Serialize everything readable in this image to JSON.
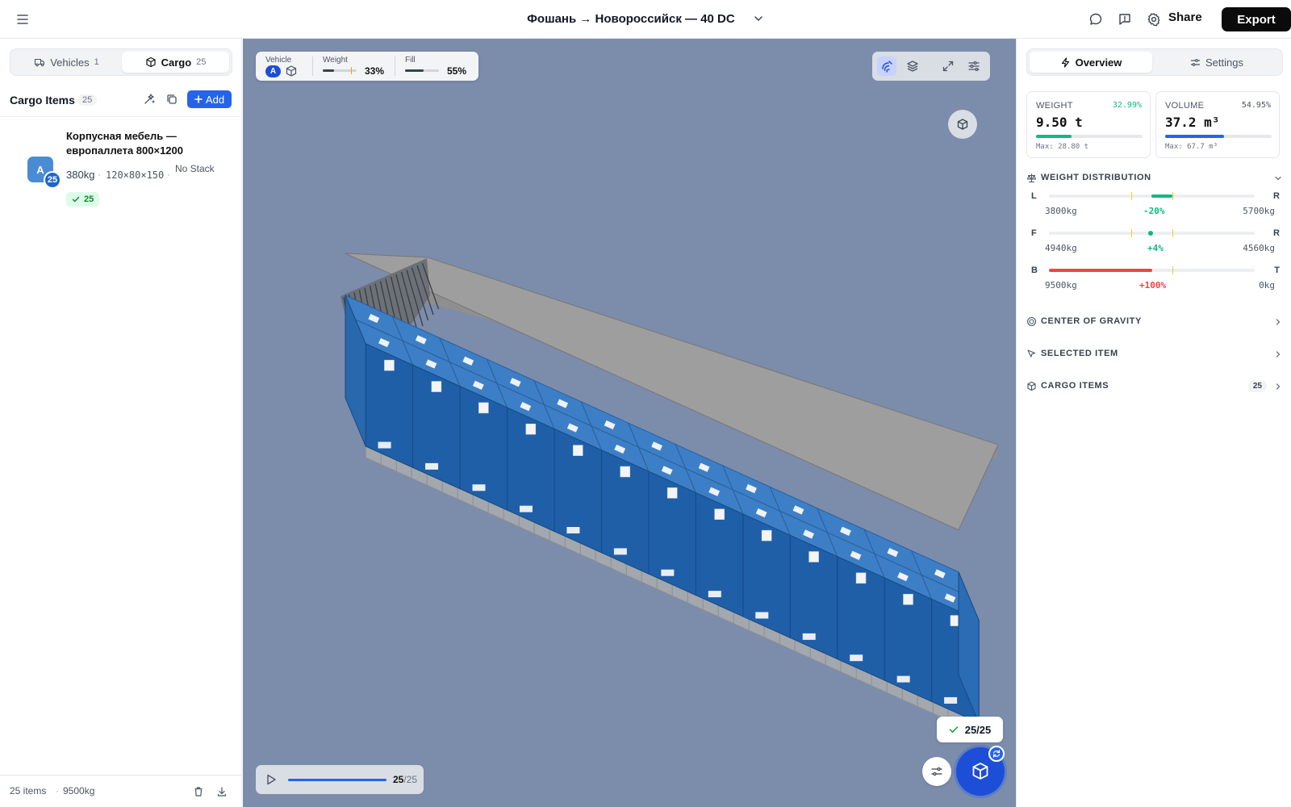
{
  "header": {
    "title": "Фошань → Новороссийск — 40 DC",
    "share_label": "Share",
    "export_label": "Export"
  },
  "left": {
    "tabs": [
      {
        "label": "Vehicles",
        "count": "1"
      },
      {
        "label": "Cargo",
        "count": "25"
      }
    ],
    "section_title": "Cargo Items",
    "section_count": "25",
    "add_label": "Add",
    "item": {
      "avatar": "A",
      "badge": "25",
      "name": "Корпусная мебель — европаллета 800×1200",
      "weight": "380kg",
      "sep": "·",
      "dims": "120×80×150",
      "stack": "No Stack",
      "placed": "25"
    },
    "footer": {
      "items": "25 items",
      "dot": "·",
      "weight": "9500kg"
    }
  },
  "viewport": {
    "stats": {
      "vehicle_label": "Vehicle",
      "vehicle_chip": "A",
      "weight_label": "Weight",
      "weight_value": "33%",
      "weight_fraction": 0.33,
      "fill_label": "Fill",
      "fill_value": "55%",
      "fill_fraction": 0.55
    },
    "placed_pill": "25/25",
    "playback": {
      "current": "25",
      "total": "/25",
      "fraction": 1.0
    }
  },
  "right": {
    "tabs": [
      {
        "label": "Overview"
      },
      {
        "label": "Settings"
      }
    ],
    "weight_card": {
      "label": "WEIGHT",
      "pct": "32.99%",
      "value": "9.50 t",
      "max": "Max: 28.80 t",
      "fraction": 0.33,
      "color": "#10b981"
    },
    "volume_card": {
      "label": "VOLUME",
      "pct": "54.95%",
      "value": "37.2 m³",
      "max": "Max: 67.7 m³",
      "fraction": 0.55,
      "color": "#2563eb"
    },
    "weight_distribution": {
      "title": "WEIGHT DISTRIBUTION",
      "rows": [
        {
          "a": "L",
          "b": "R",
          "left": "3800kg",
          "delta": "-20%",
          "right": "5700kg",
          "color": "#10b981"
        },
        {
          "a": "F",
          "b": "R",
          "left": "4940kg",
          "delta": "+4%",
          "right": "4560kg",
          "color": "#10b981"
        },
        {
          "a": "B",
          "b": "T",
          "left": "9500kg",
          "delta": "+100%",
          "right": "0kg",
          "color": "#ef4444"
        }
      ]
    },
    "sections": [
      {
        "title": "CENTER OF GRAVITY"
      },
      {
        "title": "SELECTED ITEM"
      },
      {
        "title": "CARGO ITEMS",
        "count": "25"
      }
    ]
  }
}
